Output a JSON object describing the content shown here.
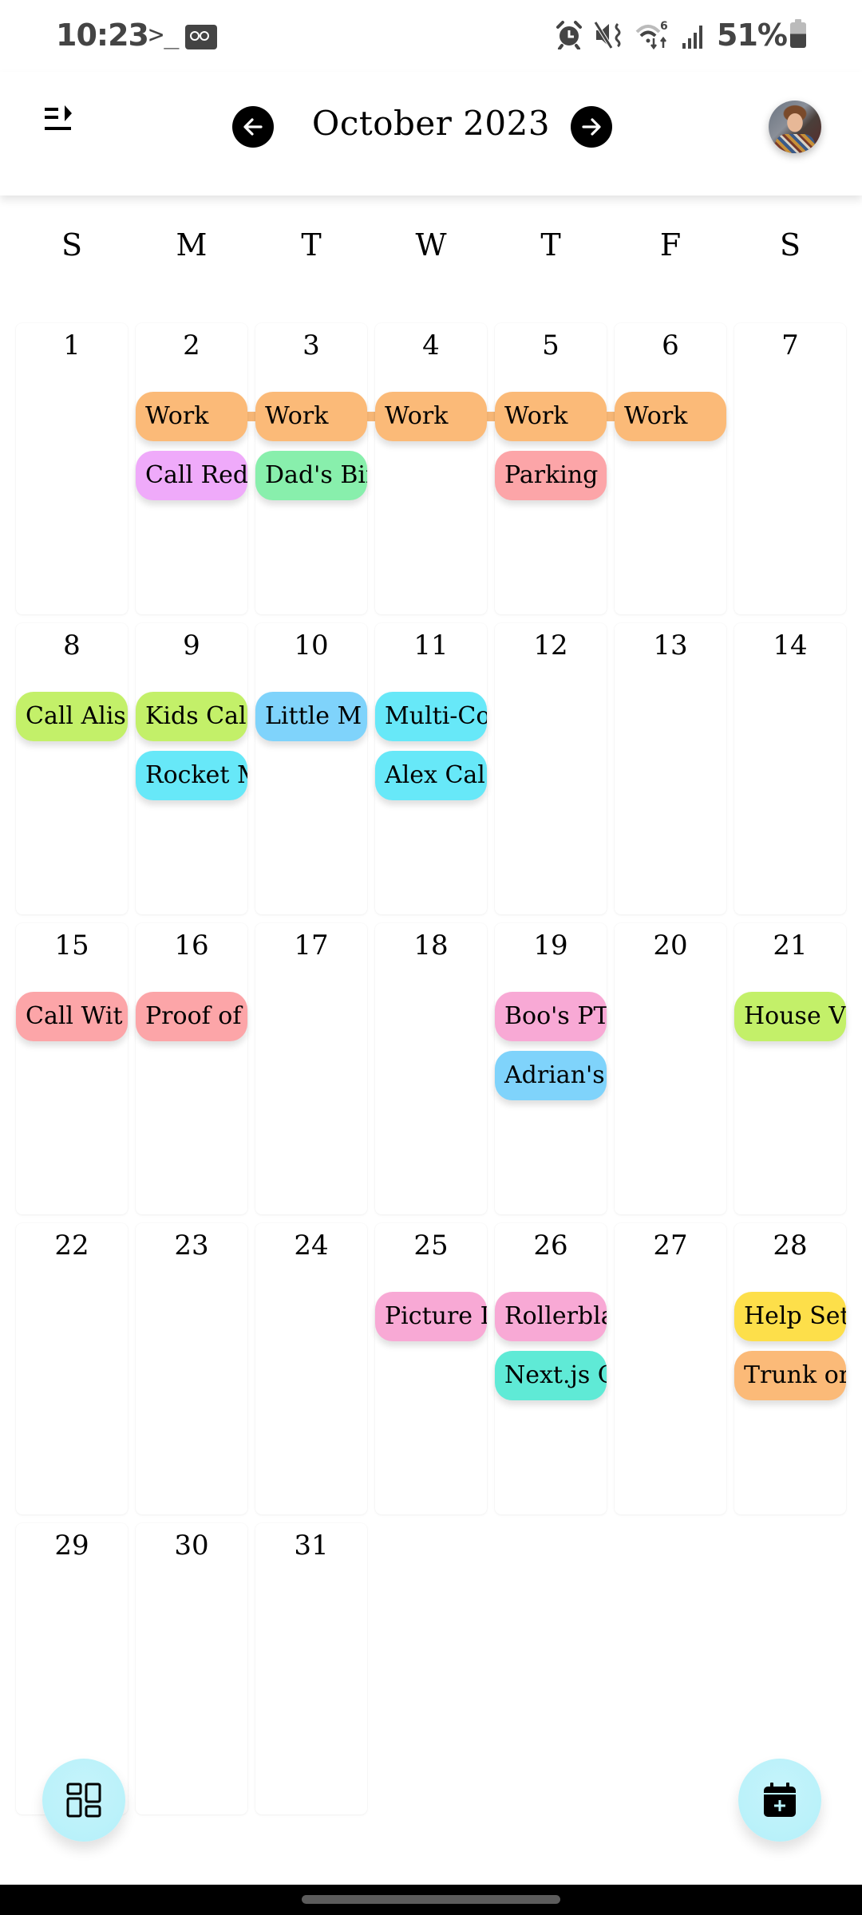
{
  "status_bar": {
    "time": "10:23",
    "terminal_glyph": ">_",
    "icons": [
      "terminal-icon",
      "voicemail-icon",
      "alarm-icon",
      "mute-vibrate-icon",
      "wifi-6-icon",
      "cell-signal-icon",
      "battery-icon"
    ],
    "battery_percent": "51%",
    "battery_level": 0.51
  },
  "header": {
    "menu_icon": "menu-expand-icon",
    "prev_label": "Previous month",
    "next_label": "Next month",
    "month_title": "October 2023",
    "avatar_alt": "User profile photo"
  },
  "weekdays": [
    "S",
    "M",
    "T",
    "W",
    "T",
    "F",
    "S"
  ],
  "colors": {
    "orange": "#fbba78",
    "purple": "#efaafa",
    "green": "#88efac",
    "red": "#fca5a8",
    "lime": "#c3f069",
    "sky": "#7fd3fb",
    "cyan": "#67e8f8",
    "pink": "#f8a9d5",
    "teal": "#5fead6",
    "yellow": "#fddf4a",
    "fab_bg": "#b9f2fb"
  },
  "weeks": [
    {
      "days": [
        {
          "day": "1",
          "events": []
        },
        {
          "day": "2",
          "events": [
            {
              "title": "Work",
              "color": "orange",
              "continues": true
            },
            {
              "title": "Call Red",
              "color": "purple"
            }
          ]
        },
        {
          "day": "3",
          "events": [
            {
              "title": "Work",
              "color": "orange",
              "continues": true
            },
            {
              "title": "Dad's Bir",
              "color": "green"
            }
          ]
        },
        {
          "day": "4",
          "events": [
            {
              "title": "Work",
              "color": "orange",
              "continues": true
            }
          ]
        },
        {
          "day": "5",
          "events": [
            {
              "title": "Work",
              "color": "orange",
              "continues": true
            },
            {
              "title": "Parking",
              "color": "red"
            }
          ]
        },
        {
          "day": "6",
          "events": [
            {
              "title": "Work",
              "color": "orange"
            }
          ]
        },
        {
          "day": "7",
          "events": []
        }
      ]
    },
    {
      "days": [
        {
          "day": "8",
          "events": [
            {
              "title": "Call Alis",
              "color": "lime"
            }
          ]
        },
        {
          "day": "9",
          "events": [
            {
              "title": "Kids Cal",
              "color": "lime"
            },
            {
              "title": "Rocket M",
              "color": "cyan"
            }
          ]
        },
        {
          "day": "10",
          "events": [
            {
              "title": "Little M",
              "color": "sky"
            }
          ]
        },
        {
          "day": "11",
          "events": [
            {
              "title": "Multi-Co",
              "color": "cyan"
            },
            {
              "title": "Alex Cal",
              "color": "cyan"
            }
          ]
        },
        {
          "day": "12",
          "events": []
        },
        {
          "day": "13",
          "events": []
        },
        {
          "day": "14",
          "events": []
        }
      ]
    },
    {
      "days": [
        {
          "day": "15",
          "events": [
            {
              "title": "Call Wit",
              "color": "red"
            }
          ]
        },
        {
          "day": "16",
          "events": [
            {
              "title": "Proof of",
              "color": "red"
            }
          ]
        },
        {
          "day": "17",
          "events": []
        },
        {
          "day": "18",
          "events": []
        },
        {
          "day": "19",
          "events": [
            {
              "title": "Boo's PT",
              "color": "pink"
            },
            {
              "title": "Adrian's",
              "color": "sky"
            }
          ]
        },
        {
          "day": "20",
          "events": []
        },
        {
          "day": "21",
          "events": [
            {
              "title": "House V",
              "color": "lime"
            }
          ]
        }
      ]
    },
    {
      "days": [
        {
          "day": "22",
          "events": []
        },
        {
          "day": "23",
          "events": []
        },
        {
          "day": "24",
          "events": []
        },
        {
          "day": "25",
          "events": [
            {
              "title": "Picture I",
              "color": "pink"
            }
          ]
        },
        {
          "day": "26",
          "events": [
            {
              "title": "Rollerbla",
              "color": "pink"
            },
            {
              "title": "Next.js C",
              "color": "teal"
            }
          ]
        },
        {
          "day": "27",
          "events": []
        },
        {
          "day": "28",
          "events": [
            {
              "title": "Help Set",
              "color": "yellow"
            },
            {
              "title": "Trunk or",
              "color": "orange"
            }
          ]
        }
      ]
    },
    {
      "days": [
        {
          "day": "29",
          "events": []
        },
        {
          "day": "30",
          "events": []
        },
        {
          "day": "31",
          "events": []
        }
      ]
    }
  ],
  "fabs": {
    "left_label": "Change view",
    "left_icon": "dashboard-layout-icon",
    "right_label": "Add event",
    "right_icon": "calendar-add-icon"
  }
}
